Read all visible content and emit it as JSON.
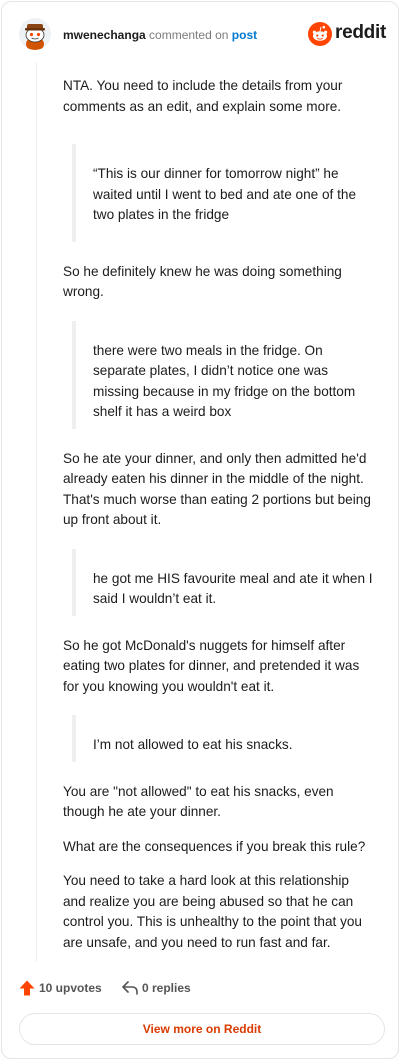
{
  "header": {
    "username": "mwenechanga",
    "action": "commented on",
    "post_link": "post",
    "brand": "reddit",
    "avatar_icon": "snoo-avatar-icon",
    "brand_icon": "reddit-logo-icon",
    "brand_color": "#ff4500"
  },
  "comment": {
    "p1": "NTA. You need to include the details from your comments as an edit, and explain some more.",
    "q1": "“This is our dinner for tomorrow night” he waited until I went to bed and ate one of the two plates in the fridge",
    "p2": "So he definitely knew he was doing something wrong.",
    "q2": "there were two meals in the fridge. On separate plates, I didn’t notice one was missing because in my fridge on the bottom shelf it has a weird box",
    "p3": "So he ate your dinner, and only then admitted he'd already eaten his dinner in the middle of the night. That's much worse than eating 2 portions but being up front about it.",
    "q3": "he got me HIS favourite meal and ate it when I said I wouldn’t eat it.",
    "p4": "So he got McDonald's nuggets for himself after eating two plates for dinner, and pretended it was for you knowing you wouldn't eat it.",
    "q4": "I’m not allowed to eat his snacks.",
    "p5": "You are \"not allowed\" to eat his snacks, even though he ate your dinner.",
    "p6": "What are the consequences if you break this rule?",
    "p7": "You need to take a hard look at this relationship and realize you are being abused so that he can control you. This is unhealthy to the point that you are unsafe, and you need to run fast and far."
  },
  "footer": {
    "upvotes": "10 upvotes",
    "replies": "0 replies",
    "upvote_icon": "upvote-arrow-icon",
    "reply_icon": "reply-arrow-icon",
    "upvote_color": "#ff4500",
    "more_label": "View more on Reddit",
    "more_color": "#d93a00"
  }
}
